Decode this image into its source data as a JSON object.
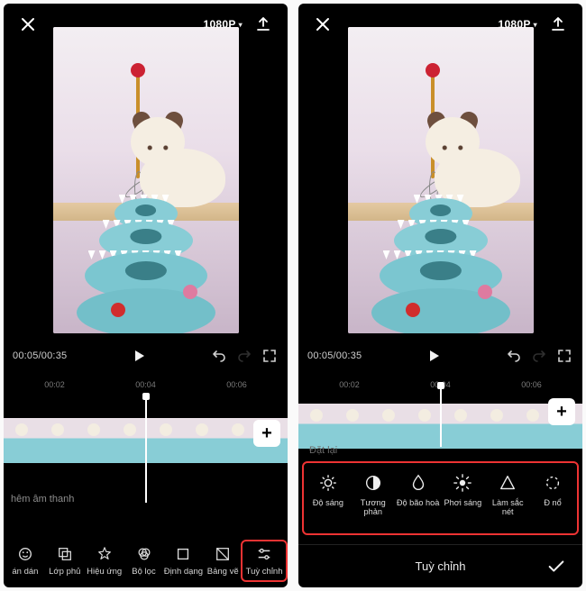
{
  "left": {
    "topbar": {
      "resolution": "1080P"
    },
    "time": {
      "current": "00:05",
      "total": "00:35"
    },
    "ticks": [
      "00:02",
      "00:04",
      "00:06"
    ],
    "audio_hint": "hêm âm thanh",
    "tools": [
      {
        "label": "án dán",
        "icon": "sticker"
      },
      {
        "label": "Lớp phủ",
        "icon": "overlay"
      },
      {
        "label": "Hiệu ứng",
        "icon": "effects"
      },
      {
        "label": "Bộ lọc",
        "icon": "filter"
      },
      {
        "label": "Định dạng",
        "icon": "format"
      },
      {
        "label": "Bảng vẽ",
        "icon": "canvas"
      },
      {
        "label": "Tuỳ chỉnh",
        "icon": "adjust"
      }
    ]
  },
  "right": {
    "topbar": {
      "resolution": "1080P"
    },
    "time": {
      "current": "00:05",
      "total": "00:35"
    },
    "ticks": [
      "00:02",
      "00:04",
      "00:06"
    ],
    "reset_label": "Đặt lại",
    "adjust": [
      {
        "label": "Độ sáng",
        "icon": "brightness"
      },
      {
        "label": "Tương phản",
        "icon": "contrast"
      },
      {
        "label": "Độ bão hoà",
        "icon": "saturation"
      },
      {
        "label": "Phơi sáng",
        "icon": "exposure"
      },
      {
        "label": "Làm sắc nét",
        "icon": "sharpen"
      },
      {
        "label": "Đ nổ",
        "icon": "more"
      }
    ],
    "confirm_title": "Tuỳ chỉnh"
  }
}
